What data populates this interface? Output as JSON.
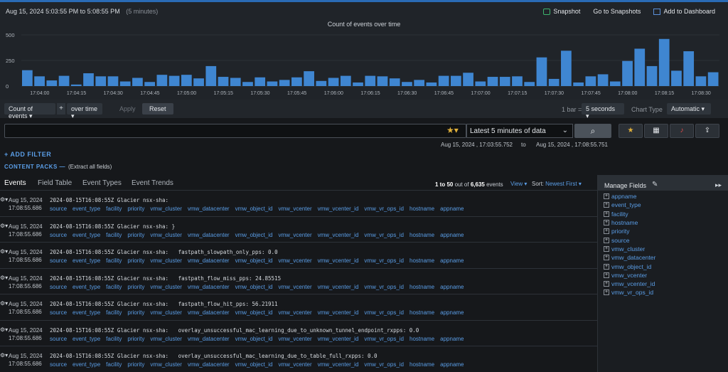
{
  "header": {
    "date": "Aug 15, 2024",
    "start": "5:03:55 PM",
    "to": "to",
    "end": "5:08:55 PM",
    "duration": "(5 minutes)",
    "actions": [
      {
        "label": "Snapshot",
        "icon": "camera-icon"
      },
      {
        "label": "Go to Snapshots",
        "icon": ""
      },
      {
        "label": "Add to Dashboard",
        "icon": "dashboard-icon"
      }
    ]
  },
  "chart_data": {
    "type": "bar",
    "title": "Count of events over time",
    "ylim": [
      0,
      500
    ],
    "yticks": [
      "500",
      "250",
      "0"
    ],
    "xticks": [
      "17:04:00",
      "17:04:15",
      "17:04:30",
      "17:04:45",
      "17:05:00",
      "17:05:15",
      "17:05:30",
      "17:05:45",
      "17:06:00",
      "17:06:15",
      "17:06:30",
      "17:06:45",
      "17:07:00",
      "17:07:15",
      "17:07:30",
      "17:07:45",
      "17:08:00",
      "17:08:15",
      "17:08:30",
      "17:08:45"
    ],
    "values": [
      155,
      95,
      55,
      100,
      15,
      125,
      95,
      95,
      45,
      80,
      40,
      110,
      100,
      110,
      75,
      195,
      90,
      80,
      40,
      85,
      45,
      60,
      85,
      145,
      50,
      80,
      100,
      35,
      100,
      95,
      75,
      40,
      60,
      35,
      100,
      100,
      130,
      45,
      90,
      90,
      95,
      40,
      280,
      70,
      345,
      35,
      95,
      115,
      45,
      245,
      365,
      195,
      460,
      150,
      340,
      95,
      135
    ],
    "grid": true,
    "color": "#3f86d1"
  },
  "controls": {
    "measure": "Count of events",
    "plus": "+",
    "over": "over time",
    "apply": "Apply",
    "reset": "Reset",
    "bar_label": "1 bar =",
    "bar_value": "5 seconds",
    "chart_type_label": "Chart Type",
    "chart_type_value": "Automatic"
  },
  "search": {
    "time_range": "Latest 5 minutes of data",
    "range_start": "Aug 15, 2024 , 17:03:55.752",
    "range_to": "to",
    "range_end": "Aug 15, 2024 , 17:08:55.751",
    "add_filter": "+ ADD FILTER",
    "content_packs": "CONTENT PACKS —",
    "extract": "(Extract all fields)"
  },
  "tabs": [
    "Events",
    "Field Table",
    "Event Types",
    "Event Trends"
  ],
  "results": {
    "range": "1 to 50",
    "out_of": "out of",
    "total": "6,635",
    "unit": "events",
    "view": "View ▾",
    "sort_label": "Sort:",
    "sort_value": "Newest First ▾"
  },
  "event_fields": [
    "source",
    "event_type",
    "facility",
    "priority",
    "vmw_cluster",
    "vmw_datacenter",
    "vmw_object_id",
    "vmw_vcenter",
    "vmw_vcenter_id",
    "vmw_vr_ops_id",
    "hostname",
    "appname"
  ],
  "events": [
    {
      "date": "Aug 15, 2024",
      "time": "17:08:55.686",
      "msg": "2024-08-15T16:08:55Z Glacier nsx-sha:"
    },
    {
      "date": "Aug 15, 2024",
      "time": "17:08:55.686",
      "msg": "2024-08-15T16:08:55Z Glacier nsx-sha: }"
    },
    {
      "date": "Aug 15, 2024",
      "time": "17:08:55.686",
      "msg": "2024-08-15T16:08:55Z Glacier nsx-sha:   fastpath_slowpath_only_pps: 0.0"
    },
    {
      "date": "Aug 15, 2024",
      "time": "17:08:55.686",
      "msg": "2024-08-15T16:08:55Z Glacier nsx-sha:   fastpath_flow_miss_pps: 24.85515"
    },
    {
      "date": "Aug 15, 2024",
      "time": "17:08:55.686",
      "msg": "2024-08-15T16:08:55Z Glacier nsx-sha:   fastpath_flow_hit_pps: 56.21911"
    },
    {
      "date": "Aug 15, 2024",
      "time": "17:08:55.686",
      "msg": "2024-08-15T16:08:55Z Glacier nsx-sha:   overlay_unsuccessful_mac_learning_due_to_unknown_tunnel_endpoint_rxpps: 0.0"
    },
    {
      "date": "Aug 15, 2024",
      "time": "17:08:55.686",
      "msg": "2024-08-15T16:08:55Z Glacier nsx-sha:   overlay_unsuccessful_mac_learning_due_to_table_full_rxpps: 0.0"
    }
  ],
  "manage_fields": {
    "title": "Manage Fields",
    "items": [
      "appname",
      "event_type",
      "facility",
      "hostname",
      "priority",
      "source",
      "vmw_cluster",
      "vmw_datacenter",
      "vmw_object_id",
      "vmw_vcenter",
      "vmw_vcenter_id",
      "vmw_vr_ops_id"
    ]
  }
}
